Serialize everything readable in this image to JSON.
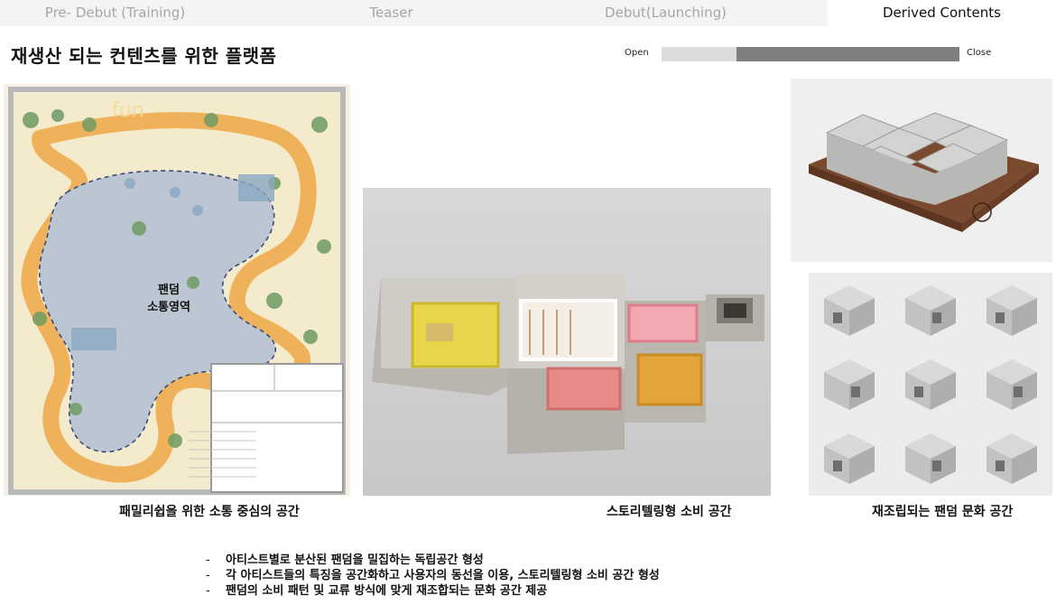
{
  "tabs": [
    {
      "label": "Pre- Debut (Training)"
    },
    {
      "label": "Teaser"
    },
    {
      "label": "Debut(Launching)"
    },
    {
      "label": "Derived Contents"
    }
  ],
  "title": "재생산 되는 컨텐츠를 위한 플랫폼",
  "open_close": {
    "open_label": "Open",
    "close_label": "Close",
    "fill_start": 0.25,
    "fill_end": 1.0
  },
  "floorplan": {
    "label_line1": "팬덤",
    "label_line2": "소통영역",
    "sign": "fun"
  },
  "captions": {
    "floorplan": "패밀리쉽을 위한 소통 중심의 공간",
    "model": "스토리텔링형 소비 공간",
    "blocks": "재조립되는 팬덤 문화 공간"
  },
  "notes": [
    {
      "dash": "-",
      "text": "아티스트별로 분산된 팬덤을 밀집하는 독립공간 형성"
    },
    {
      "dash": "-",
      "text": "각 아티스트들의 특징을 공간화하고 사용자의 동선을 이용, 스토리텔링형 소비 공간 형성"
    },
    {
      "dash": "-",
      "text": "팬덤의 소비 패턴 및 교류 방식에 맞게 재조합되는 문화 공간 제공"
    }
  ],
  "colors": {
    "accent_orange": "#f0b45a",
    "yellow": "#e8d54a",
    "pink": "#e98a8a",
    "gold": "#e3a53a"
  }
}
